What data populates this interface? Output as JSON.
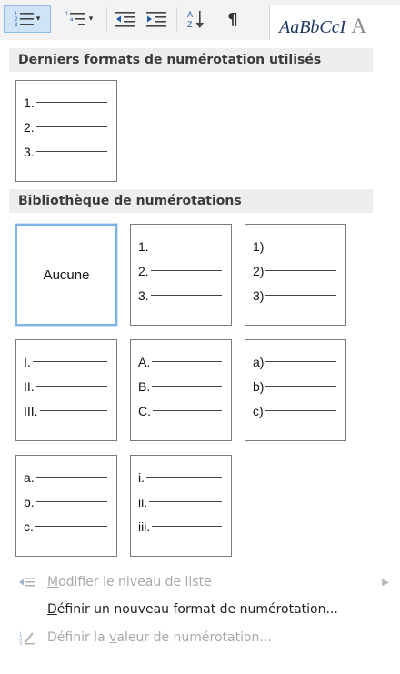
{
  "ribbon": {
    "styles_preview": "AaBbCcI",
    "styles_preview_next": "A"
  },
  "recent": {
    "header": "Derniers formats de numérotation utilisés",
    "tile": [
      "1.",
      "2.",
      "3."
    ]
  },
  "library": {
    "header": "Bibliothèque de numérotations",
    "none_label": "Aucune",
    "tiles": [
      [
        "1.",
        "2.",
        "3."
      ],
      [
        "1)",
        "2)",
        "3)"
      ],
      [
        "I.",
        "II.",
        "III."
      ],
      [
        "A.",
        "B.",
        "C."
      ],
      [
        "a)",
        "b)",
        "c)"
      ],
      [
        "a.",
        "b.",
        "c."
      ],
      [
        "i.",
        "ii.",
        "iii."
      ]
    ]
  },
  "menu": {
    "change_level": {
      "ul": "M",
      "rest": "odifier le niveau de liste"
    },
    "define_format": {
      "ul": "D",
      "rest": "éfinir un nouveau format de numérotation..."
    },
    "set_value": {
      "pre": "Définir la ",
      "ul": "v",
      "rest": "aleur de numérotation..."
    }
  }
}
